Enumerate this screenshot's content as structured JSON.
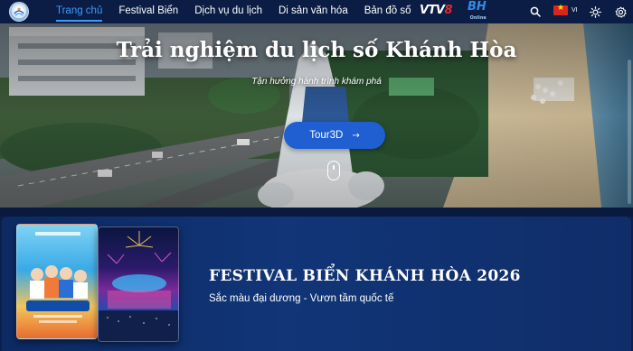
{
  "nav": {
    "items": [
      {
        "label": "Trang chủ",
        "active": true
      },
      {
        "label": "Festival Biển",
        "active": false
      },
      {
        "label": "Dịch vụ du lịch",
        "active": false
      },
      {
        "label": "Di sản văn hóa",
        "active": false
      },
      {
        "label": "Bản đồ số",
        "active": false
      }
    ],
    "partner_logos": {
      "vtv_a": "VTV",
      "vtv_b": "8",
      "bh_main": "BH",
      "bh_small": "Online"
    },
    "language_code": "VI",
    "icons": [
      "search-icon",
      "language-flag",
      "sun-icon",
      "settings-icon"
    ],
    "accent_color": "#3b9bff",
    "background_color": "#0b1d45"
  },
  "hero": {
    "title": "Trải nghiệm du lịch số Khánh Hòa",
    "subtitle": "Tận hưởng hành trình khám phá",
    "button_label": "Tour3D",
    "button_color": "#1f5fd1"
  },
  "festival": {
    "title": "FESTIVAL BIỂN KHÁNH HÒA 2026",
    "subtitle": "Sắc màu đại dương - Vươn tầm quốc tế",
    "background_color": "#113577"
  }
}
